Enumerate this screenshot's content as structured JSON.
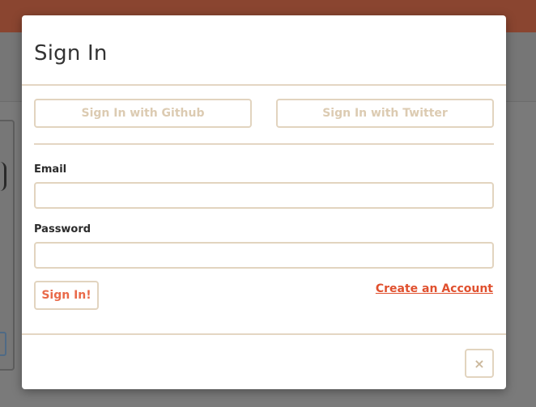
{
  "modal": {
    "title": "Sign In",
    "oauth": {
      "github_label": "Sign In with Github",
      "twitter_label": "Sign In with Twitter"
    },
    "form": {
      "email_label": "Email",
      "email_value": "",
      "email_placeholder": "",
      "password_label": "Password",
      "password_value": "",
      "password_placeholder": "",
      "submit_label": "Sign In!"
    },
    "create_account_label": "Create an Account",
    "close_label": "×"
  },
  "colors": {
    "accent": "#e0502e",
    "border": "#e2d4bf",
    "muted_text": "#dccbb2",
    "topbar": "#8a4530"
  },
  "icons": {
    "close": "close-icon"
  }
}
